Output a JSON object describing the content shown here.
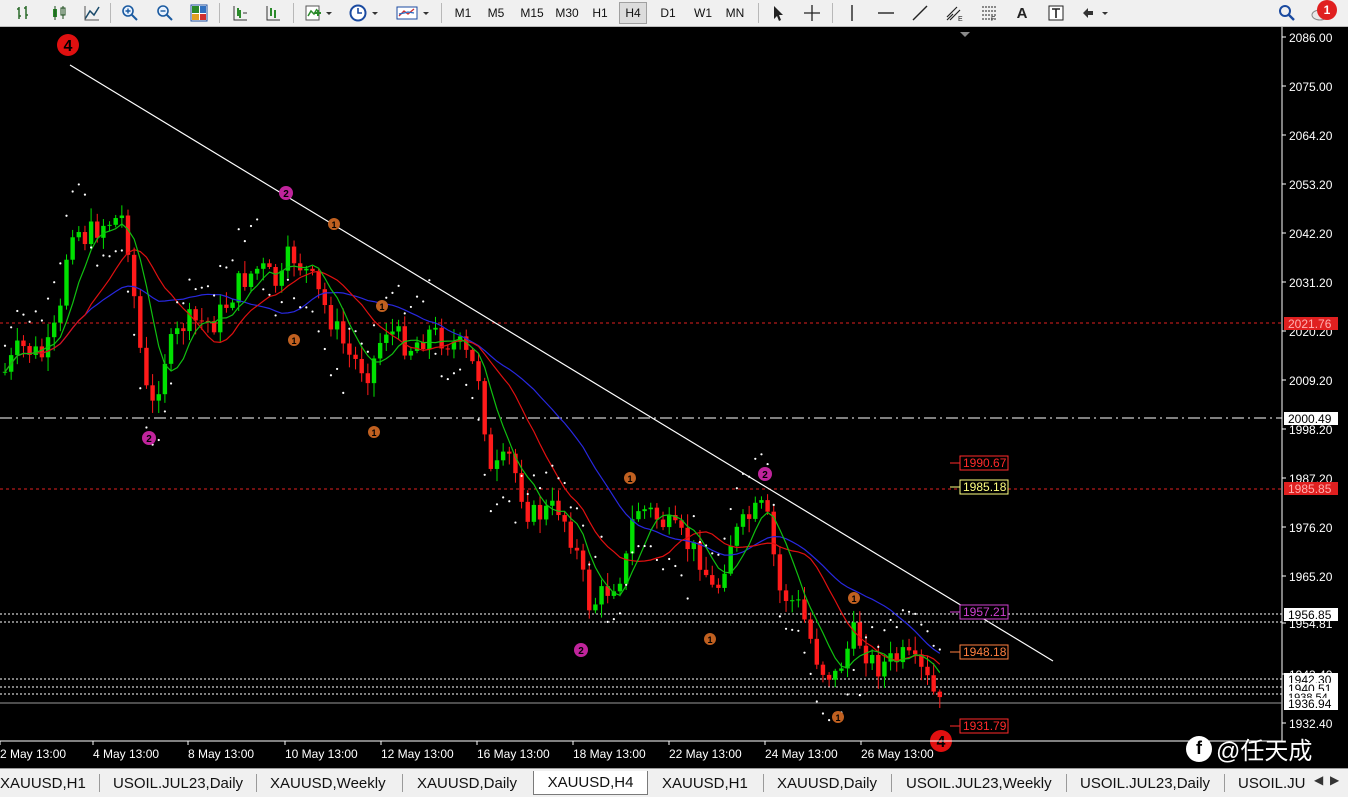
{
  "toolbar": {
    "timeframes": [
      "M1",
      "M5",
      "M15",
      "M30",
      "H1",
      "H4",
      "D1",
      "W1",
      "MN"
    ],
    "active_timeframe": "H4",
    "notification_count": "1",
    "text_tool_label": "A"
  },
  "chart": {
    "symbol": "XAUUSD",
    "period": "H4",
    "price_axis": [
      "2086.00",
      "2075.00",
      "2064.20",
      "2053.20",
      "2042.20",
      "2031.20",
      "2020.20",
      "2009.20",
      "1998.20",
      "1987.20",
      "1976.20",
      "1965.20",
      "1954.81",
      "1943.40",
      "1932.40"
    ],
    "price_tags": [
      {
        "label": "2021.76",
        "kind": "red-fill"
      },
      {
        "label": "2000.49",
        "kind": "white-fill"
      },
      {
        "label": "1985.85",
        "kind": "red-fill"
      },
      {
        "label": "1956.85",
        "kind": "white-fill"
      },
      {
        "label": "1942.30",
        "kind": "white-fill"
      },
      {
        "label": "1940.51",
        "kind": "white-fill"
      },
      {
        "label": "1938.54",
        "kind": "white-fill"
      },
      {
        "label": "1936.94",
        "kind": "white-fill"
      }
    ],
    "in_chart_labels": [
      {
        "label": "1990.67",
        "color": "#ff2a2a"
      },
      {
        "label": "1985.18",
        "color": "#ffff80"
      },
      {
        "label": "1957.21",
        "color": "#d040d0"
      },
      {
        "label": "1948.18",
        "color": "#ff8040"
      },
      {
        "label": "1931.79",
        "color": "#ff2a2a"
      }
    ],
    "time_axis": [
      "2 May 13:00",
      "4 May 13:00",
      "8 May 13:00",
      "10 May 13:00",
      "12 May 13:00",
      "16 May 13:00",
      "18 May 13:00",
      "22 May 13:00",
      "24 May 13:00",
      "26 May 13:00"
    ],
    "wave_markers": [
      {
        "label": "4",
        "color": "#e01010",
        "size": "large"
      },
      {
        "label": "2",
        "color": "#c0249c",
        "size": "small"
      },
      {
        "label": "1",
        "color": "#c06020",
        "size": "small"
      },
      {
        "label": "2",
        "color": "#c0249c",
        "size": "small"
      },
      {
        "label": "1",
        "color": "#c06020",
        "size": "small"
      },
      {
        "label": "1",
        "color": "#c06020",
        "size": "small"
      },
      {
        "label": "1",
        "color": "#c06020",
        "size": "small"
      },
      {
        "label": "2",
        "color": "#c0249c",
        "size": "small"
      },
      {
        "label": "1",
        "color": "#c06020",
        "size": "small"
      },
      {
        "label": "1",
        "color": "#c06020",
        "size": "small"
      },
      {
        "label": "2",
        "color": "#c0249c",
        "size": "small"
      },
      {
        "label": "1",
        "color": "#c06020",
        "size": "small"
      },
      {
        "label": "1",
        "color": "#c06020",
        "size": "small"
      },
      {
        "label": "4",
        "color": "#e01010",
        "size": "large"
      }
    ]
  },
  "tabs": [
    {
      "label": "XAUUSD,H1",
      "active": false
    },
    {
      "label": "USOIL.JUL23,Daily",
      "active": false
    },
    {
      "label": "XAUUSD,Weekly",
      "active": false
    },
    {
      "label": "XAUUSD,Daily",
      "active": false
    },
    {
      "label": "XAUUSD,H4",
      "active": true
    },
    {
      "label": "XAUUSD,H1",
      "active": false
    },
    {
      "label": "XAUUSD,Daily",
      "active": false
    },
    {
      "label": "USOIL.JUL23,Weekly",
      "active": false
    },
    {
      "label": "USOIL.JUL23,Daily",
      "active": false
    },
    {
      "label": "USOIL.JU",
      "active": false
    }
  ],
  "watermark": {
    "platform_icon": "f",
    "text": "@任天成"
  },
  "colors": {
    "bull": "#00e000",
    "bear": "#ff1a1a",
    "ma_fast": "#00c800",
    "ma_mid": "#e01010",
    "ma_slow": "#2020d0",
    "trendline": "#ffffff"
  }
}
